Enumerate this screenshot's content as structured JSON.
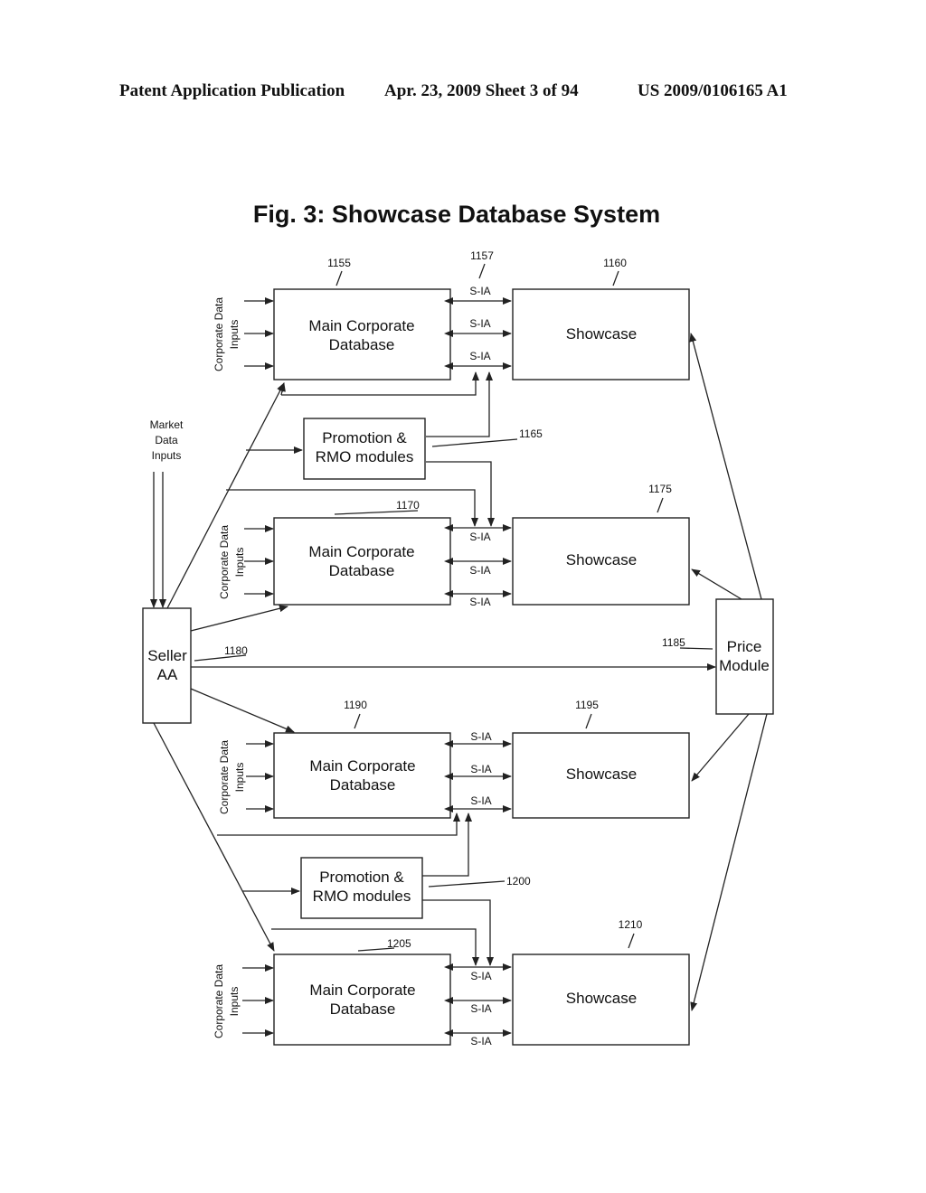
{
  "header": {
    "publication": "Patent Application Publication",
    "date_sheet": "Apr. 23, 2009  Sheet 3 of 94",
    "number": "US 2009/0106165 A1"
  },
  "figure": {
    "title": "Fig. 3: Showcase Database System",
    "market_inputs": [
      "Market",
      "Data",
      "Inputs"
    ],
    "corporate_inputs": [
      "Corporate Data",
      "Inputs"
    ],
    "main_db": [
      "Main Corporate",
      "Database"
    ],
    "showcase": "Showcase",
    "promo": [
      "Promotion &",
      "RMO modules"
    ],
    "seller": [
      "Seller",
      "AA"
    ],
    "price": [
      "Price",
      "Module"
    ],
    "sia": "S-IA",
    "refs": {
      "r1155": "1155",
      "r1157": "1157",
      "r1160": "1160",
      "r1165": "1165",
      "r1170": "1170",
      "r1175": "1175",
      "r1180": "1180",
      "r1185": "1185",
      "r1190": "1190",
      "r1195": "1195",
      "r1200": "1200",
      "r1205": "1205",
      "r1210": "1210"
    }
  }
}
